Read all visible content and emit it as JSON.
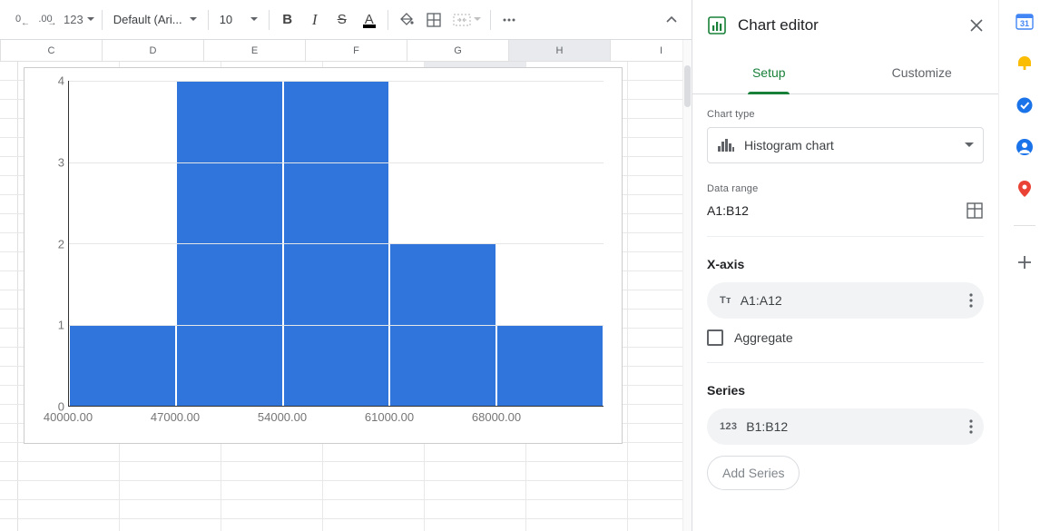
{
  "toolbar": {
    "decrease_decimal": "0",
    "increase_decimal": ".00",
    "format_more": "123",
    "font_name": "Default (Ari...",
    "font_size": "10",
    "bold": "B",
    "italic": "I",
    "strike": "S",
    "textcolor": "A"
  },
  "columns": [
    "C",
    "D",
    "E",
    "F",
    "G",
    "H",
    "I"
  ],
  "selected_column": "H",
  "chart_editor": {
    "title": "Chart editor",
    "tabs": {
      "setup": "Setup",
      "customize": "Customize"
    },
    "chart_type_label": "Chart type",
    "chart_type_value": "Histogram chart",
    "data_range_label": "Data range",
    "data_range_value": "A1:B12",
    "xaxis_title": "X-axis",
    "xaxis_range": "A1:A12",
    "aggregate_label": "Aggregate",
    "series_title": "Series",
    "series_range": "B1:B12",
    "add_series": "Add Series",
    "xaxis_prefix": "Tт",
    "series_prefix": "123"
  },
  "chart_data": {
    "type": "bar",
    "categories": [
      "40000.00",
      "47000.00",
      "54000.00",
      "61000.00",
      "68000.00"
    ],
    "values": [
      1,
      4,
      4,
      2,
      1
    ],
    "title": "",
    "xlabel": "",
    "ylabel": "",
    "ylim": [
      0,
      4
    ],
    "yticks": [
      0,
      1,
      2,
      3,
      4
    ]
  }
}
